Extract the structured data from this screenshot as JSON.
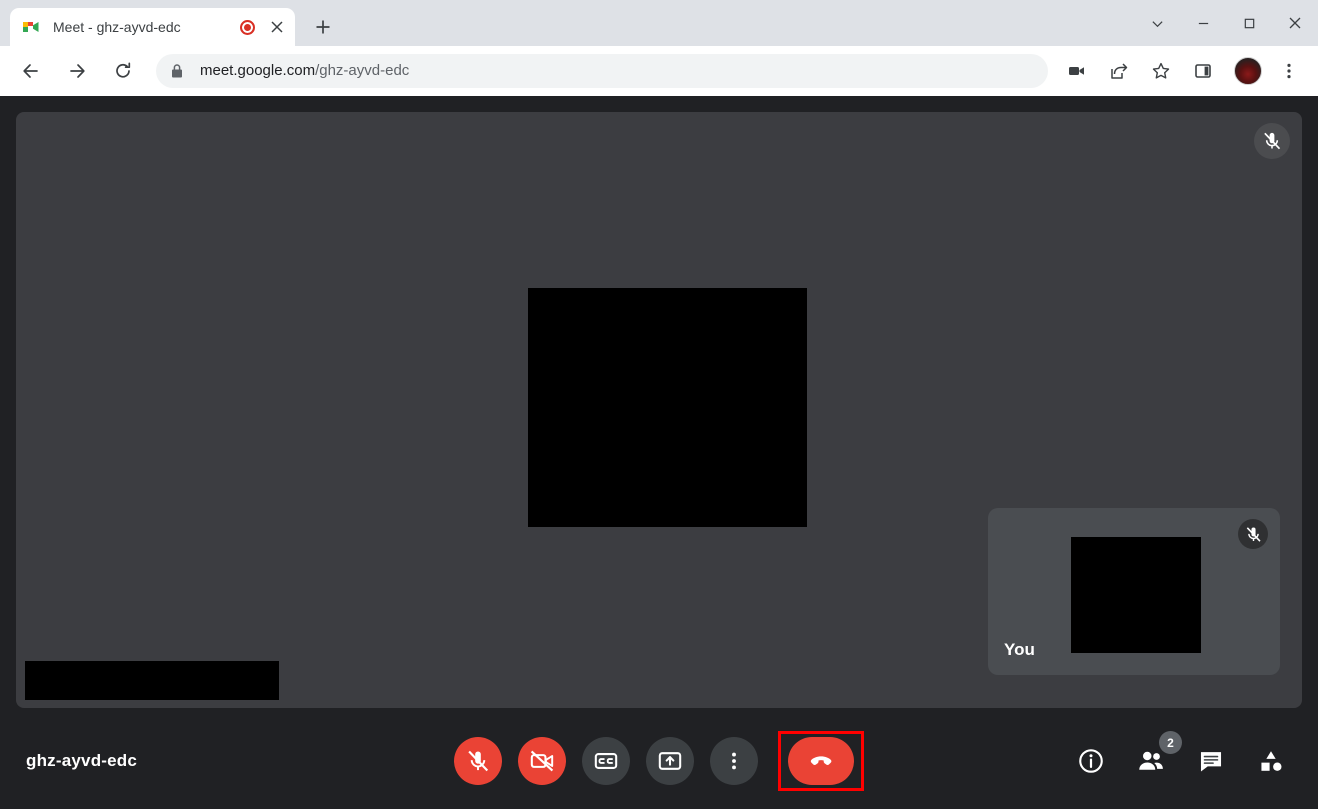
{
  "browser": {
    "tab": {
      "title": "Meet - ghz-ayvd-edc",
      "favicon_name": "google-meet-favicon",
      "recording_indicator": "recording-dot",
      "close_label": "✕"
    },
    "new_tab_label": "+",
    "window_controls": {
      "tab_search": "tab-search-chevron",
      "minimize": "minimize",
      "maximize": "maximize",
      "close": "close"
    },
    "nav": {
      "back": "back-arrow",
      "forward": "forward-arrow",
      "reload": "reload"
    },
    "omnibox": {
      "lock": "site-lock",
      "domain": "meet.google.com",
      "path": "/ghz-ayvd-edc"
    },
    "toolbar_icons": [
      {
        "name": "media-camera-indicator"
      },
      {
        "name": "share-link"
      },
      {
        "name": "bookmark-star"
      },
      {
        "name": "side-panel"
      },
      {
        "name": "profile-avatar"
      },
      {
        "name": "chrome-menu"
      }
    ]
  },
  "meet": {
    "meeting_code": "ghz-ayvd-edc",
    "stage": {
      "mic_state": "muted",
      "mic_badge_name": "mic-off-badge"
    },
    "selfview": {
      "label": "You",
      "mic_state": "muted",
      "mic_badge_name": "mic-off-badge"
    },
    "controls": [
      {
        "name": "microphone-toggle",
        "label": "Turn off microphone",
        "state": "muted",
        "style": "danger"
      },
      {
        "name": "camera-toggle",
        "label": "Turn on camera",
        "state": "off",
        "style": "danger"
      },
      {
        "name": "captions-toggle",
        "label": "Turn on captions",
        "state": "off",
        "style": "neutral"
      },
      {
        "name": "present-screen",
        "label": "Present now",
        "state": "off",
        "style": "neutral"
      },
      {
        "name": "more-options",
        "label": "More options",
        "state": "off",
        "style": "neutral"
      }
    ],
    "end_call": {
      "name": "leave-call-button",
      "label": "Leave call",
      "highlighted": true,
      "highlight_color": "#ff0000"
    },
    "right_controls": [
      {
        "name": "meeting-details",
        "label": "Meeting details",
        "badge": ""
      },
      {
        "name": "show-everyone",
        "label": "Show everyone",
        "badge": "2"
      },
      {
        "name": "chat-with-everyone",
        "label": "Chat with everyone",
        "badge": ""
      },
      {
        "name": "activities",
        "label": "Activities",
        "badge": ""
      }
    ]
  },
  "colors": {
    "accent_red": "#ea4335",
    "highlight_red": "#ff0000",
    "stage_bg": "#3c3d41",
    "app_bg": "#202124",
    "tile_bg": "#4a4d51",
    "control_bg": "#3c4043"
  }
}
